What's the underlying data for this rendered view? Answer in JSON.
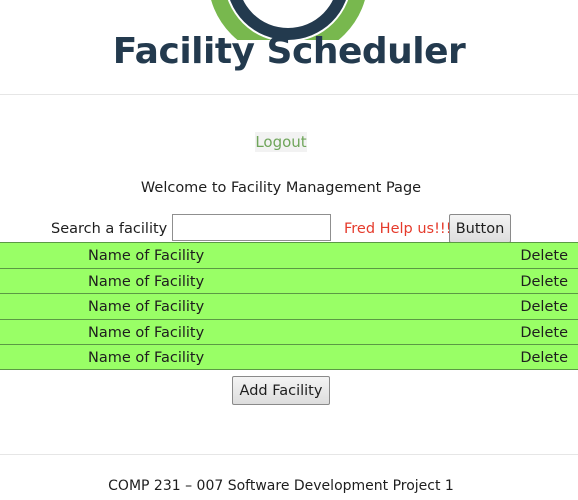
{
  "header": {
    "app_title": "Facility Scheduler",
    "logo_icon": "circular-ring-logo",
    "logo_colors": {
      "ring_outer": "#78b84e",
      "ring_inner": "#233a4e"
    }
  },
  "nav": {
    "logout_label": "Logout"
  },
  "main": {
    "welcome_text": "Welcome to Facility Management Page",
    "search": {
      "label": "Search a facility",
      "value": "",
      "placeholder": "",
      "help_text": "Fred Help us!!!",
      "button_label": "Button"
    },
    "facilities": [
      {
        "name": "Name of Facility",
        "action": "Delete"
      },
      {
        "name": "Name of Facility",
        "action": "Delete"
      },
      {
        "name": "Name of Facility",
        "action": "Delete"
      },
      {
        "name": "Name of Facility",
        "action": "Delete"
      },
      {
        "name": "Name of Facility",
        "action": "Delete"
      }
    ],
    "add_button_label": "Add Facility"
  },
  "footer": {
    "text": "COMP 231 – 007 Software Development Project 1"
  },
  "colors": {
    "title": "#233a4e",
    "row_background": "#99ff66",
    "row_border": "#5b9a44",
    "logout_text": "#6fa55a",
    "help_text": "#e53b2c"
  }
}
